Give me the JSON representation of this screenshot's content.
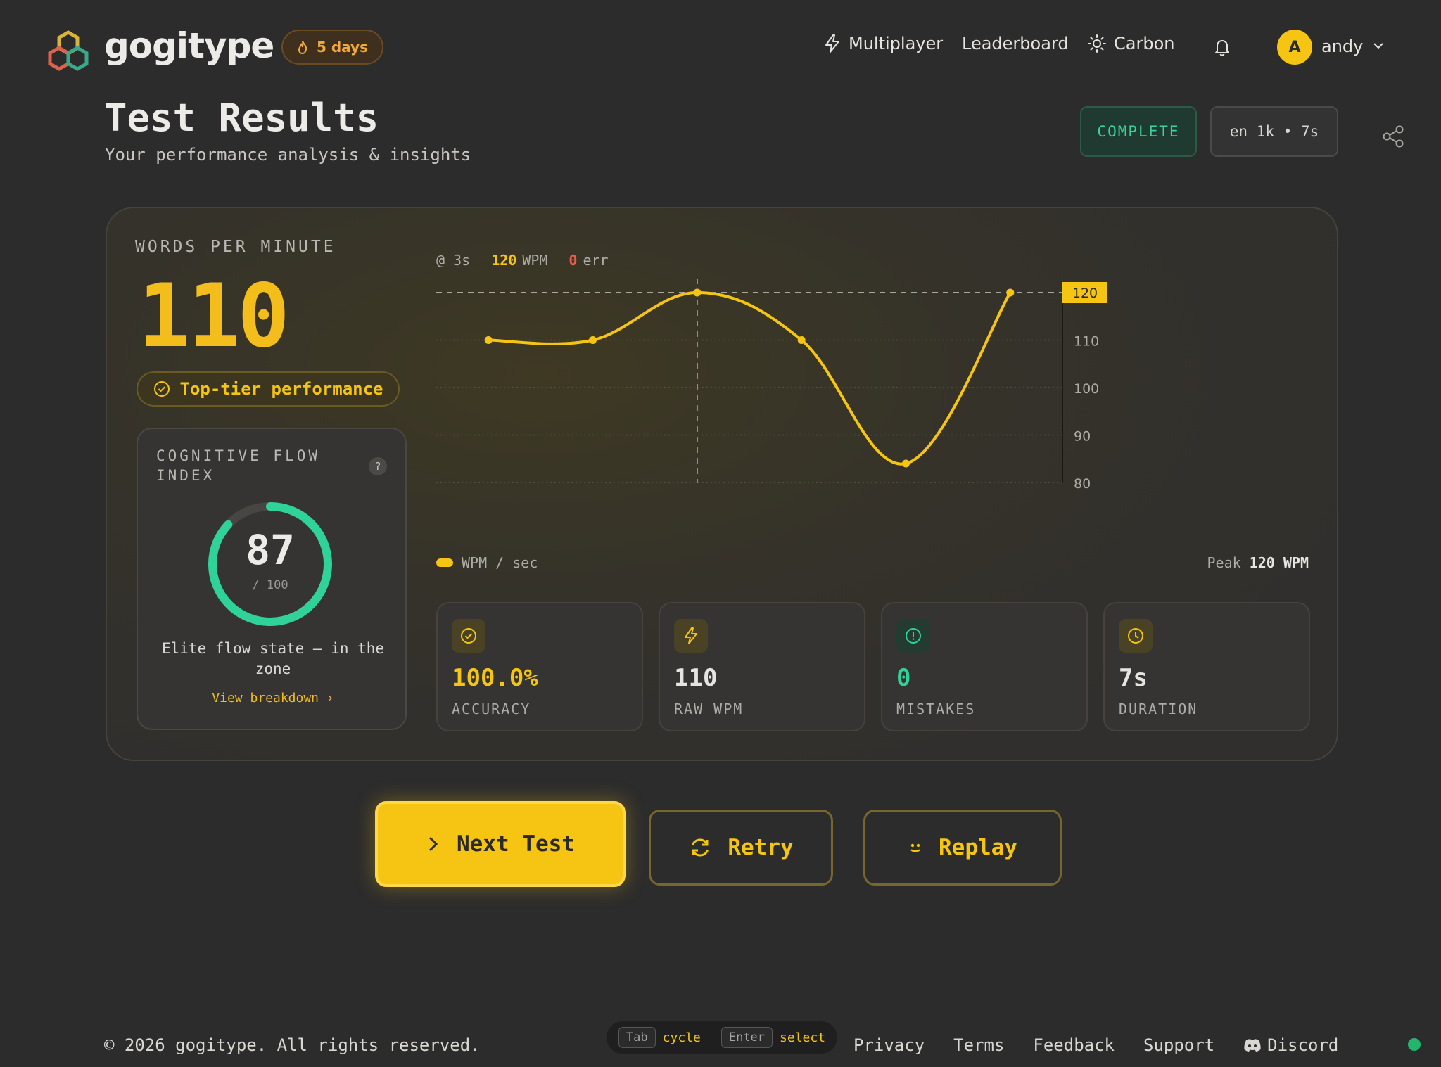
{
  "header": {
    "brand": "gogitype",
    "streak": "5 days",
    "nav": {
      "multiplayer": "Multiplayer",
      "leaderboard": "Leaderboard",
      "theme": "Carbon"
    },
    "user": {
      "initial": "A",
      "name": "andy"
    }
  },
  "page": {
    "title": "Test Results",
    "subtitle": "Your performance analysis & insights",
    "status": "COMPLETE",
    "mode": "en 1k • 7s"
  },
  "results": {
    "wpm_label": "WORDS PER MINUTE",
    "wpm": "110",
    "tier": "Top-tier performance",
    "flow": {
      "title": "COGNITIVE FLOW INDEX",
      "help": "?",
      "score": "87",
      "score_value": 87,
      "max": "/ 100",
      "description": "Elite flow state — in the zone",
      "link": "View breakdown"
    },
    "hover": {
      "time": "@ 3s",
      "wpm": "120",
      "wpm_unit": "WPM",
      "err": "0",
      "err_unit": "err"
    },
    "legend": "WPM / sec",
    "peak_label": "Peak",
    "peak_value": "120 WPM",
    "stats": [
      {
        "value": "100.0%",
        "label": "ACCURACY",
        "icon": "check-circle-icon",
        "color": "#f6c514"
      },
      {
        "value": "110",
        "label": "RAW WPM",
        "icon": "lightning-icon",
        "color": "#e6e4df"
      },
      {
        "value": "0",
        "label": "MISTAKES",
        "icon": "alert-circle-icon",
        "color": "#2fd39a"
      },
      {
        "value": "7s",
        "label": "DURATION",
        "icon": "clock-icon",
        "color": "#e6e4df"
      }
    ]
  },
  "chart_data": {
    "type": "line",
    "x": [
      1,
      2,
      3,
      4,
      5,
      6
    ],
    "series": [
      {
        "values": [
          110,
          110,
          120,
          110,
          84,
          120
        ]
      }
    ],
    "ylim": [
      80,
      120
    ],
    "yticks": [
      "120",
      "110",
      "100",
      "90",
      "80"
    ],
    "highlight": {
      "x": 3,
      "y": 120
    },
    "grid": true,
    "color": "#f6c514"
  },
  "actions": {
    "next": "Next Test",
    "retry": "Retry",
    "replay": "Replay"
  },
  "footer": {
    "copyright": "© 2026 gogitype. All rights reserved.",
    "hint": {
      "key1": "Tab",
      "action1": "cycle",
      "key2": "Enter",
      "action2": "select"
    },
    "links": {
      "privacy": "Privacy",
      "terms": "Terms",
      "feedback": "Feedback",
      "support": "Support",
      "discord": "Discord"
    }
  }
}
